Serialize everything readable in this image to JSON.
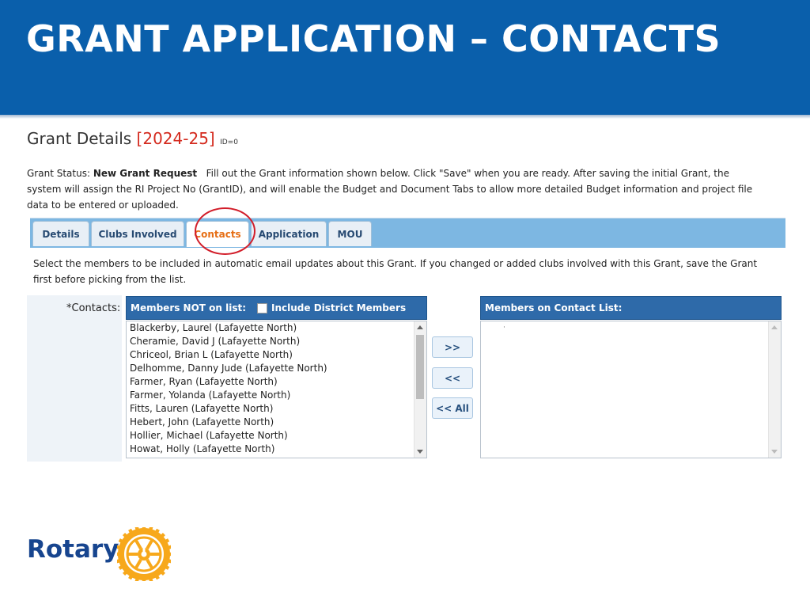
{
  "slide": {
    "title": "GRANT APPLICATION – CONTACTS"
  },
  "grant": {
    "heading": "Grant Details",
    "year": "[2024-25]",
    "id_label": "ID=0",
    "status_label": "Grant Status:",
    "status_value": "New Grant Request",
    "status_text": "Fill out the Grant information shown below. Click \"Save\" when you are ready. After saving the initial Grant, the system will assign the RI Project No (GrantID), and will enable the Budget and Document Tabs to allow more detailed Budget information and project file data to be entered or uploaded."
  },
  "tabs": [
    {
      "label": "Details",
      "active": false
    },
    {
      "label": "Clubs Involved",
      "active": false
    },
    {
      "label": "Contacts",
      "active": true
    },
    {
      "label": "Application",
      "active": false
    },
    {
      "label": "MOU",
      "active": false
    }
  ],
  "contacts": {
    "help_text": "Select the members to be included in automatic email updates about this Grant. If you changed or added clubs involved with this Grant, save the Grant first before picking from the list.",
    "field_label": "*Contacts:",
    "left_header": "Members NOT on list:",
    "include_district_label": "Include District Members",
    "include_district_checked": false,
    "right_header": "Members on Contact List:",
    "available_members": [
      "Blackerby, Laurel (Lafayette North)",
      "Cheramie, David J (Lafayette North)",
      "Chriceol, Brian L (Lafayette North)",
      "Delhomme, Danny Jude (Lafayette North)",
      "Farmer, Ryan (Lafayette North)",
      "Farmer, Yolanda (Lafayette North)",
      "Fitts, Lauren (Lafayette North)",
      "Hebert, John (Lafayette North)",
      "Hollier, Michael (Lafayette North)",
      "Howat, Holly (Lafayette North)"
    ],
    "selected_members": [],
    "buttons": {
      "add": ">>",
      "remove": "<<",
      "remove_all": "<< All"
    }
  },
  "brand": {
    "name": "Rotary",
    "primary": "#17458f",
    "gold": "#f7a81b",
    "banner": "#0a5fab"
  }
}
